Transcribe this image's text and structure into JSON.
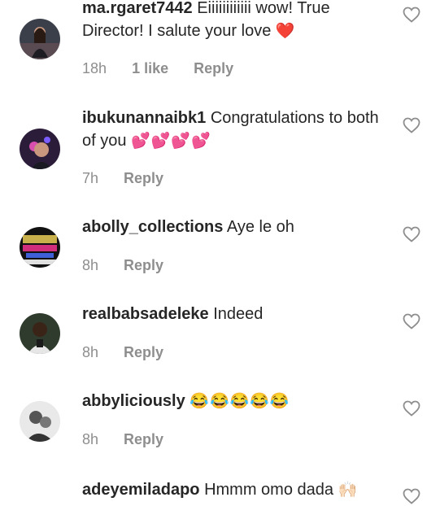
{
  "comments": [
    {
      "username": "ma.rgaret7442",
      "text": "Eiiiiiiiiiiii wow! True Director! I salute your love",
      "emoji": "❤️",
      "time": "18h",
      "likes": "1 like",
      "reply": "Reply"
    },
    {
      "username": "ibukunannaibk1",
      "text": "Congratulations to both of you",
      "emoji": "💕💕💕💕",
      "time": "7h",
      "reply": "Reply"
    },
    {
      "username": "abolly_collections",
      "text": "Aye le oh",
      "time": "8h",
      "reply": "Reply"
    },
    {
      "username": "realbabsadeleke",
      "text": "Indeed",
      "time": "8h",
      "reply": "Reply"
    },
    {
      "username": "abbyliciously",
      "text": "",
      "emoji": "😂😂😂😂😂",
      "time": "8h",
      "reply": "Reply"
    },
    {
      "username": "adeyemiladapo",
      "text": "Hmmm omo dada",
      "emoji": "🙌🏻"
    }
  ],
  "colors": {
    "text": "#262626",
    "meta": "#8e8e8e",
    "heart_stroke": "#8e8e8e",
    "emoji_heart": "#e0245e"
  },
  "icons": {
    "like": "heart-outline-icon"
  }
}
